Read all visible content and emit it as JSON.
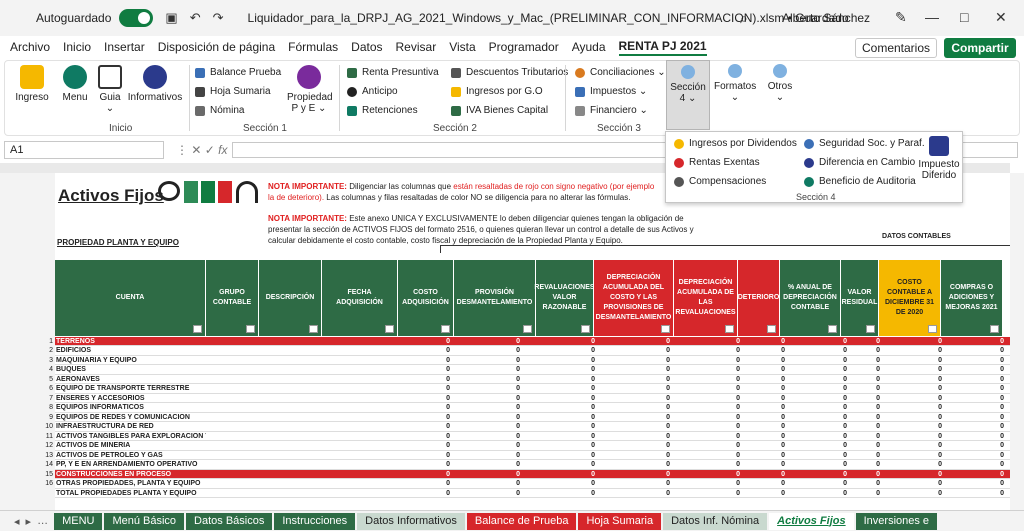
{
  "titlebar": {
    "autosave": "Autoguardado",
    "filename": "Liquidador_para_la_DRPJ_AG_2021_Windows_y_Mac_(PRELIMINAR_CON_INFORMACION).xlsm • Guardado",
    "user": "Alberto Sánchez"
  },
  "menu": [
    "Archivo",
    "Inicio",
    "Insertar",
    "Disposición de página",
    "Fórmulas",
    "Datos",
    "Revisar",
    "Vista",
    "Programador",
    "Ayuda",
    "RENTA PJ 2021"
  ],
  "menu_active": "RENTA PJ 2021",
  "comments": "Comentarios",
  "share": "Compartir",
  "ribbon": {
    "ingreso": "Ingreso",
    "menu": "Menu",
    "guia": "Guia",
    "informativos": "Informativos",
    "inicio_group": "Inicio",
    "balance": "Balance Prueba",
    "hoja": "Hoja Sumaria",
    "nomina": "Nómina",
    "propiedad": "Propiedad",
    "pye": "P y E",
    "s1": "Sección 1",
    "renta": "Renta Presuntiva",
    "anticipo": "Anticipo",
    "retenciones": "Retenciones",
    "descuentos": "Descuentos Tributarios",
    "ingresos_go": "Ingresos por G.O",
    "iva": "IVA Bienes Capital",
    "s2": "Sección 2",
    "conciliaciones": "Conciliaciones",
    "impuestos": "Impuestos",
    "financiero": "Financiero",
    "s3": "Sección 3",
    "seccion4": "Sección",
    "seccion4_num": "4",
    "formatos": "Formatos",
    "otros": "Otros",
    "dd_dividendos": "Ingresos por Dividendos",
    "dd_rentas": "Rentas Exentas",
    "dd_compensaciones": "Compensaciones",
    "dd_seguridad": "Seguridad Soc. y Paraf.",
    "dd_cambio": "Diferencia en Cambio",
    "dd_auditoria": "Beneficio de Auditoria",
    "dd_impuesto": "Impuesto",
    "dd_diferido": "Diferido",
    "dd_section": "Sección 4"
  },
  "namebox": "A1",
  "sheet": {
    "title": "Activos Fijos",
    "nota1_label": "NOTA IMPORTANTE:",
    "nota1_a": "Diligenciar las columnas que",
    "nota1_red": "están resaltadas de rojo con signo negativo (por ejemplo la",
    "nota1_b": "de deterioro).",
    "nota1_c": "Las columnas y filas resaltadas de color NO se diligencia para no alterar las fórmulas.",
    "nota2_label": "NOTA IMPORTANTE:",
    "nota2_a": "Este anexo UNICA Y EXCLUSIVAMENTE lo deben diligenciar quienes tengan la obligación de",
    "nota2_b": "presentar la sección de ACTIVOS FIJOS del formato 2516, o quienes quieran llevar un control a detalle de sus Activos",
    "nota2_c": "y calcular debidamente el costo contable, costo fiscal y depreciación de la Propiedad Planta y Equipo.",
    "ppe": "PROPIEDAD PLANTA Y EQUIPO",
    "datos_contables": "DATOS CONTABLES",
    "headers": [
      "CUENTA",
      "GRUPO CONTABLE",
      "DESCRIPCIÓN",
      "FECHA ADQUISICIÓN",
      "COSTO ADQUISICIÓN",
      "PROVISIÓN DESMANTELAMIENTO",
      "REVALUACIONES VALOR RAZONABLE",
      "DEPRECIACIÓN ACUMULADA DEL COSTO Y LAS PROVISIONES DE DESMANTELAMIENTO",
      "DEPRECIACIÓN ACUMULADA DE LAS REVALUACIONES",
      "DETERIORO",
      "% ANUAL DE DEPRECIACIÓN CONTABLE",
      "VALOR RESIDUAL",
      "COSTO CONTABLE A DICIEMBRE 31 DE 2020",
      "COMPRAS O ADICIONES Y MEJORAS 2021"
    ],
    "rows": [
      {
        "n": "1",
        "name": "TERRENOS",
        "red": true
      },
      {
        "n": "2",
        "name": "EDIFICIOS"
      },
      {
        "n": "3",
        "name": "MAQUINARIA Y EQUIPO"
      },
      {
        "n": "4",
        "name": "BUQUES"
      },
      {
        "n": "5",
        "name": "AERONAVES"
      },
      {
        "n": "6",
        "name": "EQUIPO DE TRANSPORTE TERRESTRE"
      },
      {
        "n": "7",
        "name": "ENSERES Y ACCESORIOS"
      },
      {
        "n": "8",
        "name": "EQUIPOS INFORMÁTICOS"
      },
      {
        "n": "9",
        "name": "EQUIPOS DE REDES Y COMUNICACIÓN"
      },
      {
        "n": "10",
        "name": "INFRAESTRUCTURA DE RED"
      },
      {
        "n": "11",
        "name": "ACTIVOS TANGIBLES PARA EXPLORACIÓN Y EVALUACIÓN"
      },
      {
        "n": "12",
        "name": "ACTIVOS DE MINERÍA"
      },
      {
        "n": "13",
        "name": "ACTIVOS DE PETRÓLEO Y GAS"
      },
      {
        "n": "14",
        "name": "PP, Y E EN ARRENDAMIENTO OPERATIVO"
      },
      {
        "n": "15",
        "name": "CONSTRUCCIONES EN PROCESO",
        "red": true
      },
      {
        "n": "16",
        "name": "OTRAS PROPIEDADES, PLANTA Y EQUIPO"
      },
      {
        "n": "",
        "name": "TOTAL PROPIEDADES PLANTA Y EQUIPO"
      }
    ],
    "zero": "0"
  },
  "tabs": [
    "MENU",
    "Menú Básico",
    "Datos Básicos",
    "Instrucciones",
    "Datos Informativos",
    "Balance de Prueba",
    "Hoja Sumaria",
    "Datos Inf. Nómina",
    "Activos Fijos",
    "Inversiones e"
  ]
}
